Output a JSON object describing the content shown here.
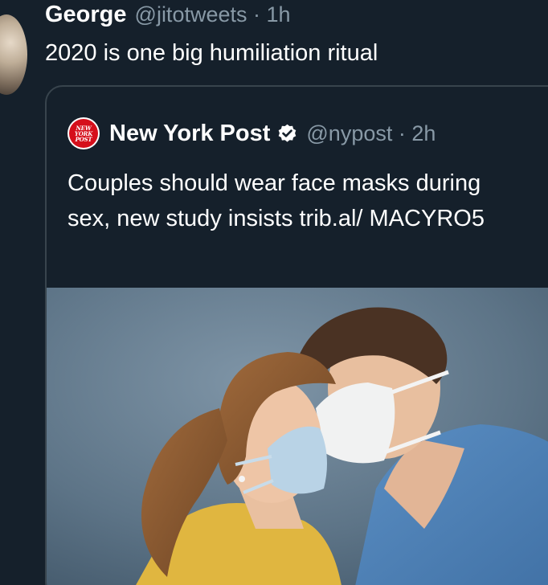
{
  "tweet": {
    "author_name": "George",
    "handle": "@jitotweets",
    "time": "· 1h",
    "text": "2020 is one big humiliation ritual"
  },
  "quoted": {
    "logo_text": [
      "NEW",
      "YORK",
      "POST"
    ],
    "author_name": "New York Post",
    "verified": true,
    "handle": "@nypost",
    "time": "· 2h",
    "text": "Couples should wear face masks during sex, new study insists trib.al/ MACYRO5",
    "image_alt": "couple-kissing-wearing-face-masks"
  },
  "colors": {
    "background": "#15202b",
    "border": "#38444d",
    "secondary_text": "#8899a6",
    "nyp_red": "#d50f1b"
  }
}
